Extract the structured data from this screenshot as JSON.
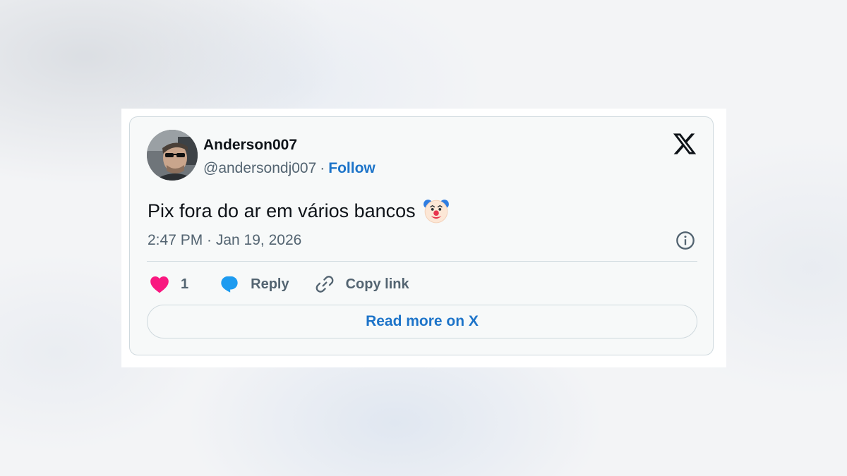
{
  "author": {
    "display_name": "Anderson007",
    "handle": "@andersondj007",
    "separator": "·",
    "follow_label": "Follow"
  },
  "tweet": {
    "text": "Pix fora do ar em vários bancos",
    "emoji_icon": "clown-face-emoji",
    "timestamp": "2:47 PM · Jan 19, 2026"
  },
  "actions": {
    "like_count": "1",
    "reply_label": "Reply",
    "copy_label": "Copy link"
  },
  "read_more_label": "Read more on X",
  "icons": {
    "brand": "x-logo-icon",
    "info": "info-icon",
    "like": "heart-icon",
    "reply": "speech-bubble-icon",
    "copy": "link-icon"
  },
  "colors": {
    "accent": "#1d74c9",
    "heart": "#f91880",
    "reply_bubble": "#1d9bf0",
    "text_primary": "#0f1419",
    "text_secondary": "#536471",
    "border": "#cfd9de",
    "card_bg": "#f7f9f9"
  }
}
